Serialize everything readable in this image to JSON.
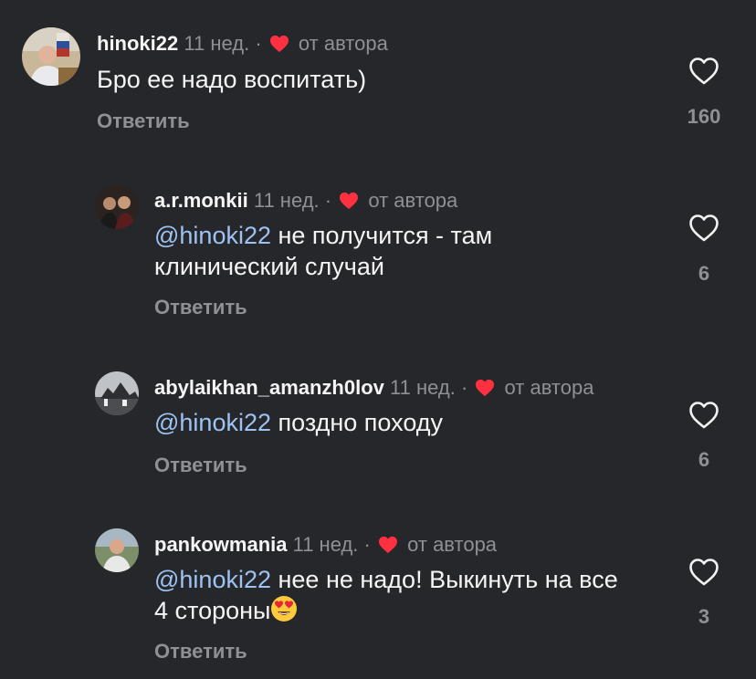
{
  "comments": [
    {
      "username": "hinoki22",
      "time": "11 нед.",
      "dot": "·",
      "author_label": "от автора",
      "text": "Бро ее надо воспитать)",
      "reply_label": "Ответить",
      "likes": "160"
    },
    {
      "username": "a.r.monkii",
      "time": "11 нед.",
      "dot": "·",
      "author_label": "от автора",
      "mention": "@hinoki22",
      "text_line1": " не получится - там",
      "text_line2": "клинический случай",
      "reply_label": "Ответить",
      "likes": "6"
    },
    {
      "username": "abylaikhan_amanzh0lov",
      "time": "11 нед.",
      "dot": "·",
      "author_label": "от автора",
      "mention": "@hinoki22",
      "text_line1": " поздно походу",
      "reply_label": "Ответить",
      "likes": "6"
    },
    {
      "username": "pankowmania",
      "time": "11 нед.",
      "dot": "·",
      "author_label": "от автора",
      "mention": "@hinoki22",
      "text_line1": " нее не надо! Выкинуть на все",
      "text_line2": "4 стороны",
      "reply_label": "Ответить",
      "likes": "3",
      "emoji": "heart-eyes-emoji"
    }
  ],
  "icons": {
    "like": "heart-outline-icon",
    "author_like": "heart-filled-icon"
  },
  "colors": {
    "background": "#26272b",
    "heart_red": "#ff3040",
    "mention": "#9ec3f2",
    "secondary_text": "#8f9096"
  }
}
